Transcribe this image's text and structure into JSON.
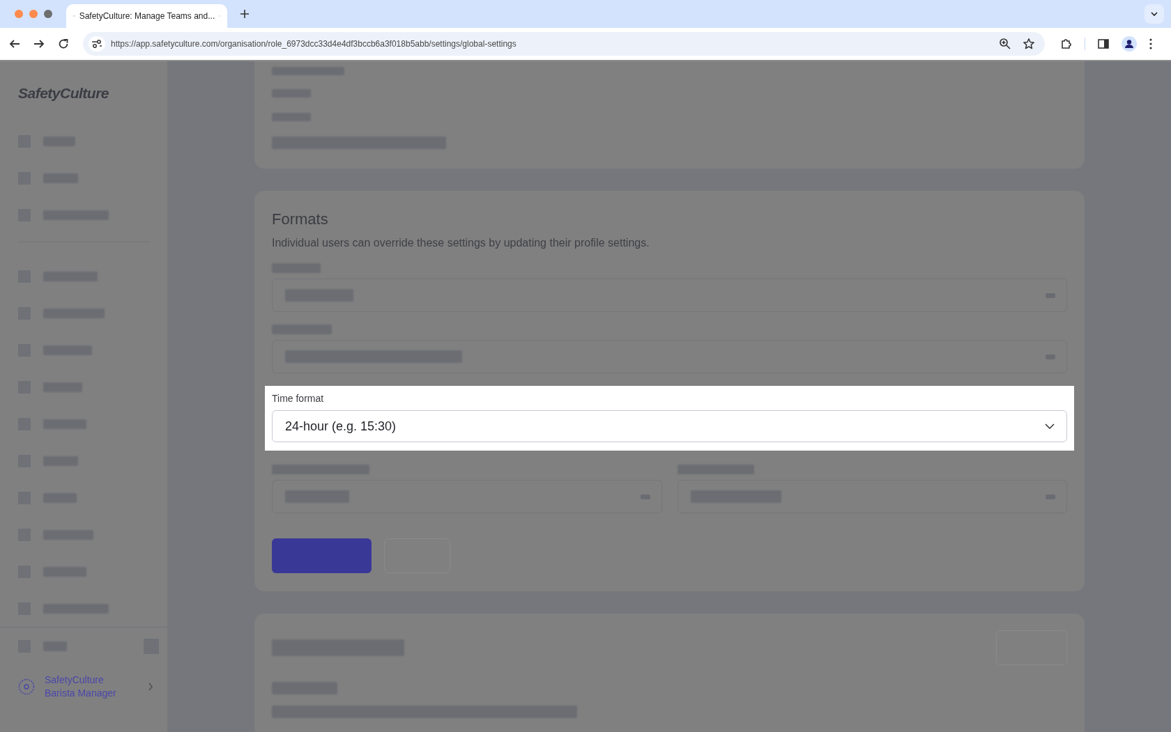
{
  "browser": {
    "tabs": [
      {
        "title": "SafetyCulture: Manage Teams and...",
        "selected": true
      }
    ],
    "url": "https://app.safetyculture.com/organisation/role_6973dcc33d4e4df3bccb6a3f018b5abb/settings/global-settings"
  },
  "sidebar": {
    "logo": "SafetyCulture",
    "user": {
      "organisation": "SafetyCulture",
      "role": "Barista Manager"
    }
  },
  "formats": {
    "title": "Formats",
    "description": "Individual users can override these settings by updating their profile settings.",
    "time_format": {
      "label": "Time format",
      "value": "24-hour (e.g. 15:30)"
    }
  }
}
